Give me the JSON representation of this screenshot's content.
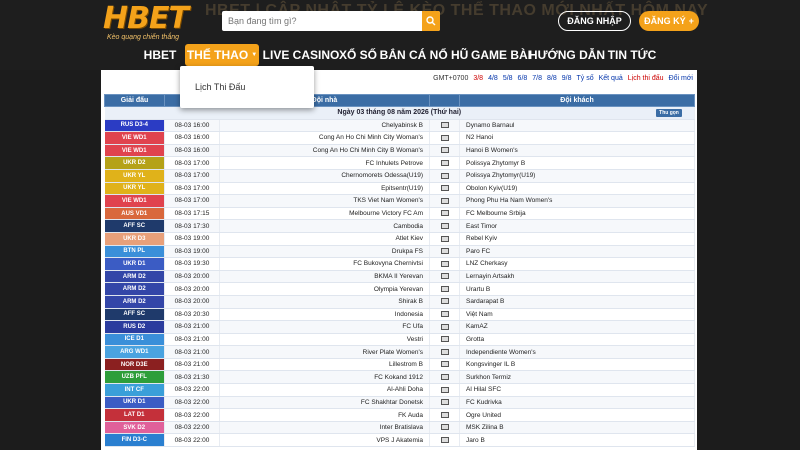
{
  "header": {
    "banner": "HBET | CẬP NHẬT TỶ LỆ KÈO THỂ THAO MỚI NHẤT HÔM NAY",
    "logo_main": "HBET",
    "logo_sub": "Kèo quạng chiến thắng",
    "search_placeholder": "Bạn đang tìm gì?",
    "login_label": "ĐĂNG NHẬP",
    "register_label": "ĐĂNG KÝ"
  },
  "nav": [
    {
      "label": "HBET"
    },
    {
      "label": "THỂ THAO"
    },
    {
      "label": "LIVE CASINO"
    },
    {
      "label": "XỔ SỐ"
    },
    {
      "label": "BẮN CÁ"
    },
    {
      "label": "NỔ HŨ"
    },
    {
      "label": "GAME BÀI"
    },
    {
      "label": "HƯỚNG DẪN"
    },
    {
      "label": "TIN TỨC"
    }
  ],
  "dropdown": {
    "item": "Lịch Thi Đấu"
  },
  "topbar": {
    "gmt": "GMT+0700",
    "dates": [
      "3/8",
      "4/8",
      "5/8",
      "6/8",
      "7/8",
      "8/8",
      "9/8"
    ],
    "tyso": "Tỷ số",
    "ketqua": "Kết quả",
    "lichthidau": "Lịch thi đấu",
    "doimoi": "Đổi mới"
  },
  "table": {
    "headers": {
      "league": "Giải đấu",
      "time": "",
      "home": "Đội nhà",
      "icon": "",
      "away": "Đội khách"
    },
    "day_label": "Ngày 03 tháng 08 năm 2026 (Thứ hai)",
    "close_label": "Thu gọn",
    "rows": [
      {
        "league": "RUS D3-4",
        "color": "#2b3cc4",
        "time": "08-03 16:00",
        "home": "Chelyabinsk B",
        "away": "Dynamo Barnaul"
      },
      {
        "league": "VIE WD1",
        "color": "#e0434e",
        "time": "08-03 16:00",
        "home": "Cong An Ho Chi Minh City Woman's",
        "away": "N2 Hanoi"
      },
      {
        "league": "VIE WD1",
        "color": "#e0434e",
        "time": "08-03 16:00",
        "home": "Cong An Ho Chi Minh City B Woman's",
        "away": "Hanoi B Women's"
      },
      {
        "league": "UKR D2",
        "color": "#b5a218",
        "time": "08-03 17:00",
        "home": "FC Inhulets Petrove",
        "away": "Polissya Zhytomyr B"
      },
      {
        "league": "UKR YL",
        "color": "#e0b21a",
        "time": "08-03 17:00",
        "home": "Chernomorets Odessa(U19)",
        "away": "Polissya Zhytomyr(U19)"
      },
      {
        "league": "UKR YL",
        "color": "#e0b21a",
        "time": "08-03 17:00",
        "home": "Epitsentr(U19)",
        "away": "Obolon Kyiv(U19)"
      },
      {
        "league": "VIE WD1",
        "color": "#e0434e",
        "time": "08-03 17:00",
        "home": "TKS Viet Nam Women's",
        "away": "Phong Phu Ha Nam Women's"
      },
      {
        "league": "AUS VD1",
        "color": "#d9683c",
        "time": "08-03 17:15",
        "home": "Melbourne Victory FC Am",
        "away": "FC Melbourne Srbija"
      },
      {
        "league": "AFF SC",
        "color": "#1f3a6b",
        "time": "08-03 17:30",
        "home": "Cambodia",
        "away": "East Timor"
      },
      {
        "league": "UKR D3",
        "color": "#e8a07a",
        "time": "08-03 19:00",
        "home": "Atlet Kiev",
        "away": "Rebel Kyiv"
      },
      {
        "league": "BTN PL",
        "color": "#3a8fd9",
        "time": "08-03 19:00",
        "home": "Drukpa FS",
        "away": "Paro FC"
      },
      {
        "league": "UKR D1",
        "color": "#3b5cc4",
        "time": "08-03 19:30",
        "home": "FC Bukovyna Chernivtsi",
        "away": "LNZ Cherkasy"
      },
      {
        "league": "ARM D2",
        "color": "#3346a8",
        "time": "08-03 20:00",
        "home": "BKMA II Yerevan",
        "away": "Lernayin Artsakh"
      },
      {
        "league": "ARM D2",
        "color": "#3346a8",
        "time": "08-03 20:00",
        "home": "Olympia Yerevan",
        "away": "Urartu B"
      },
      {
        "league": "ARM D2",
        "color": "#3346a8",
        "time": "08-03 20:00",
        "home": "Shirak B",
        "away": "Sardarapat B"
      },
      {
        "league": "AFF SC",
        "color": "#1f3a6b",
        "time": "08-03 20:30",
        "home": "Indonesia",
        "away": "Việt Nam"
      },
      {
        "league": "RUS D2",
        "color": "#2b3c9e",
        "time": "08-03 21:00",
        "home": "FC Ufa",
        "away": "KamAZ"
      },
      {
        "league": "ICE D1",
        "color": "#3a8fd9",
        "time": "08-03 21:00",
        "home": "Vestri",
        "away": "Grotta"
      },
      {
        "league": "ARG WD1",
        "color": "#4aa3e0",
        "time": "08-03 21:00",
        "home": "River Plate Women's",
        "away": "Independiente Women's"
      },
      {
        "league": "NOR D3E",
        "color": "#8b2020",
        "time": "08-03 21:00",
        "home": "Lillestrom B",
        "away": "Kongsvinger IL B"
      },
      {
        "league": "UZB PFL",
        "color": "#2e9e3a",
        "time": "08-03 21:30",
        "home": "FC Kokand 1912",
        "away": "Surkhon Termiz"
      },
      {
        "league": "INT CF",
        "color": "#3a9fd9",
        "time": "08-03 22:00",
        "home": "Al-Ahli Doha",
        "away": "Al Hilal SFC"
      },
      {
        "league": "UKR D1",
        "color": "#3b5cc4",
        "time": "08-03 22:00",
        "home": "FC Shakhtar Donetsk",
        "away": "FC Kudrivka"
      },
      {
        "league": "LAT D1",
        "color": "#c4303a",
        "time": "08-03 22:00",
        "home": "FK Auda",
        "away": "Ogre United"
      },
      {
        "league": "SVK D2",
        "color": "#e0609a",
        "time": "08-03 22:00",
        "home": "Inter Bratislava",
        "away": "MSK Zilina B"
      },
      {
        "league": "FIN D3-C",
        "color": "#2a7fd0",
        "time": "08-03 22:00",
        "home": "VPS J Akatemia",
        "away": "Jaro B"
      }
    ]
  }
}
